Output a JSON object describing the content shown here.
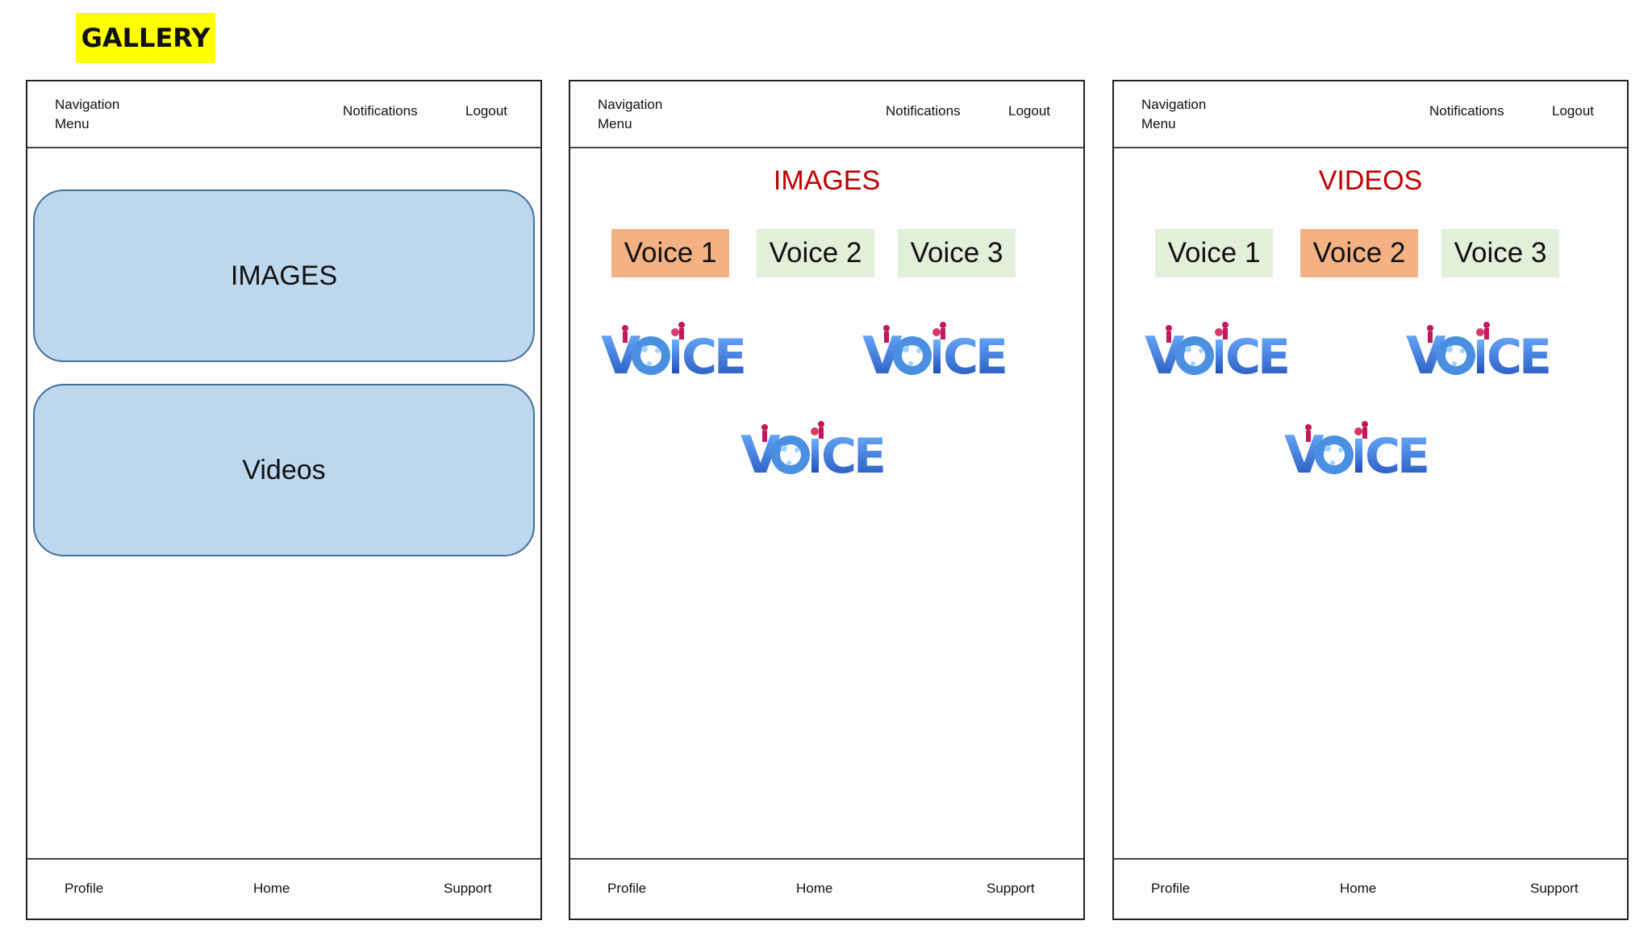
{
  "page": {
    "title": "GALLERY"
  },
  "common": {
    "nav_menu": [
      "Navigation",
      "Menu"
    ],
    "notifications": "Notifications",
    "logout": "Logout",
    "footer": {
      "profile": "Profile",
      "home": "Home",
      "support": "Support"
    }
  },
  "screen_home": {
    "cards": [
      {
        "label": "IMAGES"
      },
      {
        "label": "Videos"
      }
    ]
  },
  "screen_images": {
    "title": "IMAGES",
    "tabs": [
      {
        "label": "Voice 1",
        "active": true
      },
      {
        "label": "Voice 2",
        "active": false
      },
      {
        "label": "Voice 3",
        "active": false
      }
    ],
    "logos": [
      "VOiCE",
      "VOiCE",
      "VOiCE"
    ]
  },
  "screen_videos": {
    "title": "VIDEOS",
    "tabs": [
      {
        "label": "Voice 1",
        "active": false
      },
      {
        "label": "Voice 2",
        "active": true
      },
      {
        "label": "Voice 3",
        "active": false
      }
    ],
    "logos": [
      "VOiCE",
      "VOiCE",
      "VOiCE"
    ]
  },
  "colors": {
    "highlight": "#ffff00",
    "card_fill": "#bdd7ee",
    "card_border": "#41719c",
    "section_title": "#c00000",
    "tab_active": "#f4b183",
    "tab_inactive": "#e2efd9",
    "logo_blue": "#2f6fd6"
  },
  "icons": {
    "logo": "voice-logo"
  }
}
